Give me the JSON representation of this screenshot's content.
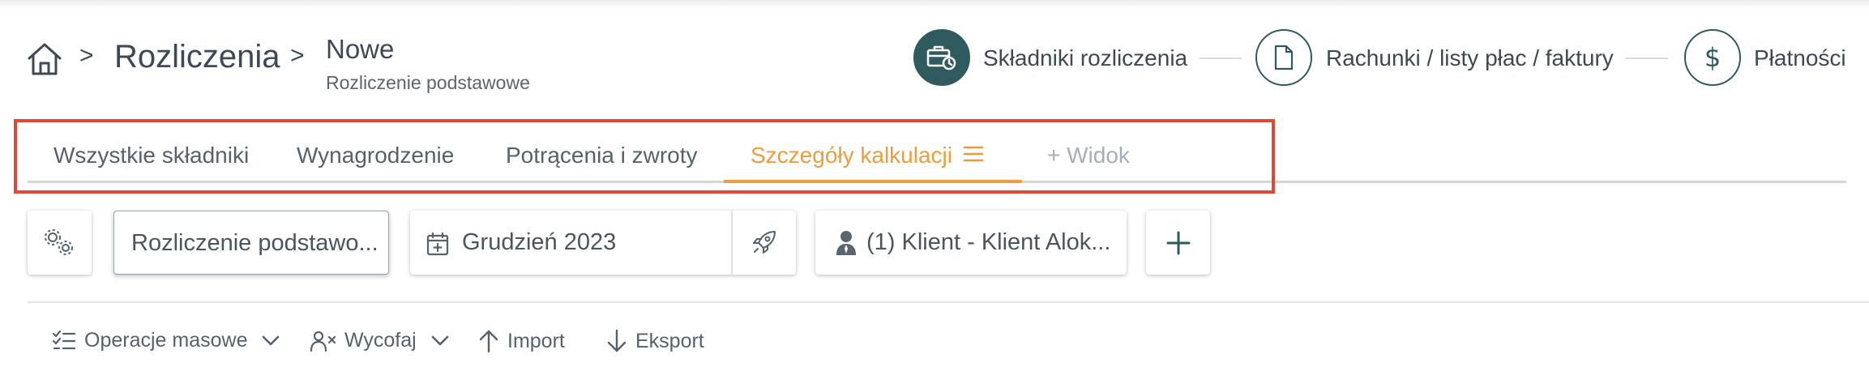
{
  "breadcrumb": {
    "separator": ">",
    "title": "Rozliczenia",
    "sub_title": "Nowe",
    "sub_caption": "Rozliczenie podstawowe"
  },
  "stepper": {
    "steps": [
      {
        "label": "Składniki rozliczenia",
        "icon": "briefcase-clock-icon",
        "active": true
      },
      {
        "label": "Rachunki / listy płac / faktury",
        "icon": "document-icon",
        "active": false
      },
      {
        "label": "Płatności",
        "icon": "dollar-icon",
        "active": false
      }
    ],
    "accent": "#2f5a5e"
  },
  "tabs": {
    "items": [
      {
        "label": "Wszystkie składniki",
        "active": false
      },
      {
        "label": "Wynagrodzenie",
        "active": false
      },
      {
        "label": "Potrącenia i zwroty",
        "active": false
      },
      {
        "label": "Szczegóły kalkulacji",
        "active": true
      },
      {
        "label": "+ Widok",
        "active": false
      }
    ],
    "active_color": "#ec9d3c",
    "highlight_color": "#e04a35"
  },
  "filters": {
    "settings_icon": "gears-icon",
    "settlement": "Rozliczenie podstawo...",
    "period": "Grudzień 2023",
    "period_icon": "calendar-plus-icon",
    "rocket_icon": "rocket-icon",
    "client": "(1) Klient - Klient Alok...",
    "client_icon": "person-icon",
    "add_icon": "plus-icon"
  },
  "actions": {
    "mass_operations": "Operacje masowe",
    "withdraw": "Wycofaj",
    "import": "Import",
    "export": "Eksport"
  }
}
